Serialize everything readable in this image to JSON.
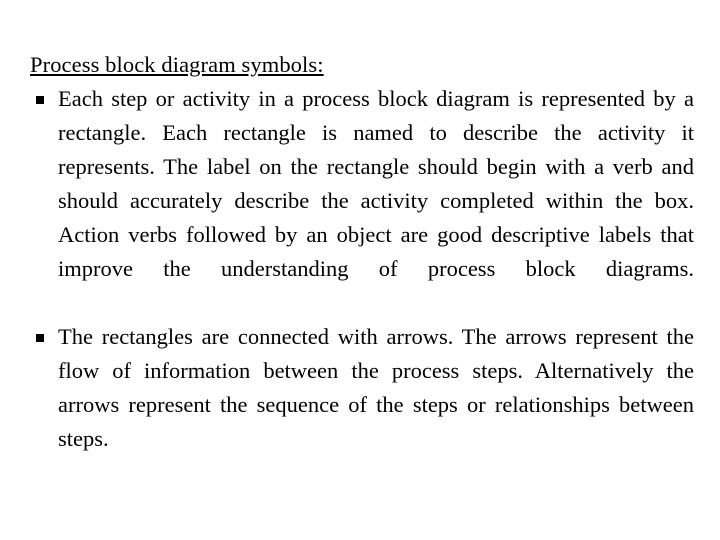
{
  "slide": {
    "heading": "Process block diagram symbols:",
    "bullet_glyph": "square-bullet",
    "bullets": [
      {
        "text": "Each step or activity in a process block diagram is represented by a rectangle.  Each rectangle is named to describe the activity it represents.  The label on the rectangle should begin with a verb and should accurately describe the activity completed within the box.  Action verbs followed by an object are good descriptive labels that improve the understanding of process block diagrams."
      },
      {
        "text": "The rectangles are connected with arrows. The arrows represent the flow of information between the process steps.  Alternatively the arrows represent the sequence of the steps or relationships between steps."
      }
    ],
    "colors": {
      "background": "#ffffff",
      "text": "#000000"
    }
  }
}
